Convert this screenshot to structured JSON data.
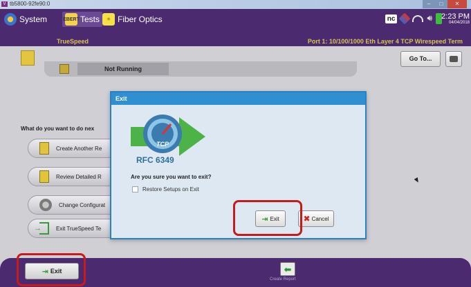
{
  "window": {
    "title": "tb5800-92fe90:0",
    "logo_text": "V"
  },
  "header": {
    "tabs": [
      {
        "label": "System",
        "icon": "system-icon"
      },
      {
        "label": "Tests",
        "icon": "tests-icon",
        "icon_text": "EBERT",
        "active": true
      },
      {
        "label": "Fiber Optics",
        "icon": "fiber-optics-icon"
      }
    ],
    "app_name": "TrueSpeed",
    "port_info": "Port 1: 10/100/1000 Eth Layer 4 TCP Wirespeed Term",
    "nc_badge": "nc",
    "clock_time": "2:23 PM",
    "clock_date": "04/04/2018"
  },
  "toolbar": {
    "goto_label": "Go To...",
    "status_label": "Not Running"
  },
  "main": {
    "question": "What do you want to do nex",
    "options": [
      {
        "label": "Create Another Re",
        "icon": "document-icon"
      },
      {
        "label": "Review Detailed R",
        "icon": "document-icon"
      },
      {
        "label": "Change Configurat",
        "icon": "gear-icon"
      },
      {
        "label": "Exit TrueSpeed Te",
        "icon": "exit-icon"
      }
    ]
  },
  "footer": {
    "exit_label": "Exit",
    "create_report_label": "Create Report"
  },
  "dialog": {
    "title": "Exit",
    "logo_badge": "TCP",
    "logo_text": "RFC 6349",
    "question": "Are you sure you want to exit?",
    "checkbox_label": "Restore Setups on Exit",
    "checkbox_checked": false,
    "exit_label": "Exit",
    "cancel_label": "Cancel"
  },
  "colors": {
    "header_purple": "#4b2a70",
    "accent_yellow": "#d9c44a",
    "dialog_blue": "#2f8fd0",
    "highlight_red": "#c81a1a"
  }
}
